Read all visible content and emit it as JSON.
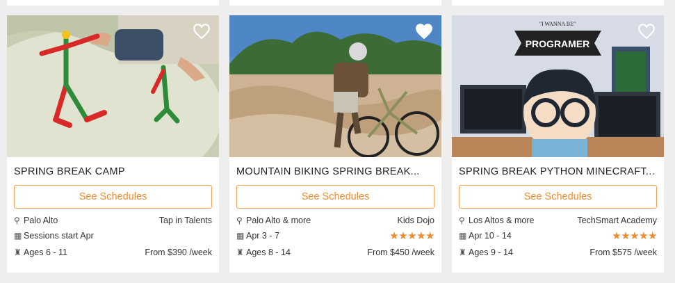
{
  "colors": {
    "accent": "#f08a2c",
    "background": "#eeeeee",
    "card": "#ffffff"
  },
  "cards": [
    {
      "title": "SPRING BREAK CAMP",
      "button": "See Schedules",
      "location": "Palo Alto",
      "provider": "Tap in Talents",
      "dates": "Sessions start Apr",
      "ages": "Ages 6 - 11",
      "price": "From $390 /week",
      "rating": null,
      "favorited": false
    },
    {
      "title": "MOUNTAIN BIKING SPRING BREAK...",
      "button": "See Schedules",
      "location": "Palo Alto & more",
      "provider": "Kids Dojo",
      "dates": "Apr 3 - 7",
      "ages": "Ages 8 - 14",
      "price": "From $450 /week",
      "rating": 5,
      "favorited": false
    },
    {
      "title": "SPRING BREAK PYTHON MINECRAFT...",
      "button": "See Schedules",
      "location": "Los Altos & more",
      "provider": "TechSmart Academy",
      "dates": "Apr 10 - 14",
      "ages": "Ages 9 - 14",
      "price": "From $575 /week",
      "rating": 5,
      "favorited": false,
      "image_text": {
        "banner_small": "\"I WANNA BE\"",
        "banner": "PROGRAMER"
      }
    }
  ],
  "icons": {
    "location": "map-pin-icon",
    "calendar": "calendar-icon",
    "ages": "person-icon",
    "favorite": "heart-outline-icon",
    "rating": "star-icon"
  }
}
